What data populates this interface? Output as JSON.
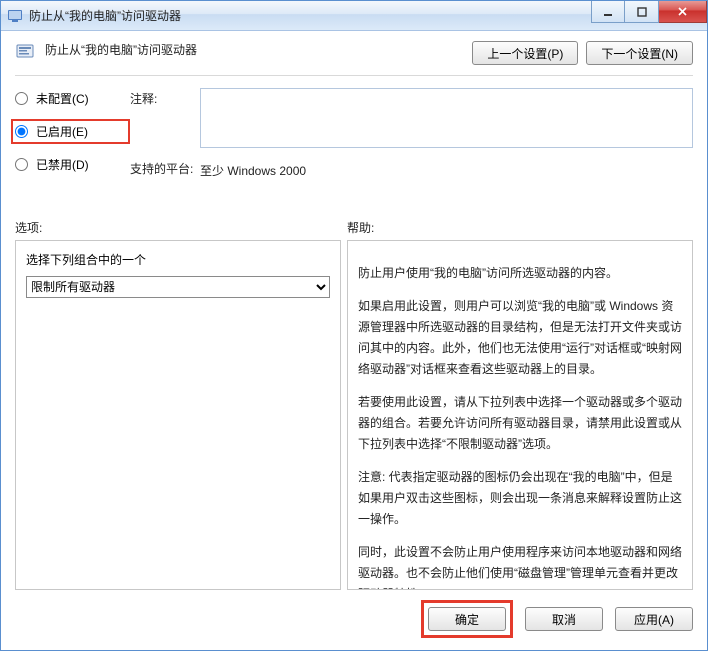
{
  "window": {
    "title": "防止从“我的电脑”访问驱动器"
  },
  "header": {
    "title": "防止从“我的电脑”访问驱动器",
    "prev_button": "上一个设置(P)",
    "next_button": "下一个设置(N)"
  },
  "state": {
    "not_configured": "未配置(C)",
    "enabled": "已启用(E)",
    "disabled": "已禁用(D)",
    "selected": "enabled"
  },
  "meta": {
    "comment_label": "注释:",
    "comment_value": "",
    "platform_label": "支持的平台:",
    "platform_value": "至少 Windows 2000"
  },
  "sections": {
    "options_label": "选项:",
    "help_label": "帮助:"
  },
  "options": {
    "caption": "选择下列组合中的一个",
    "selected": "限制所有驱动器",
    "choices": [
      "限制所有驱动器"
    ]
  },
  "help": {
    "p1": "防止用户使用“我的电脑”访问所选驱动器的内容。",
    "p2": "如果启用此设置，则用户可以浏览“我的电脑”或 Windows 资源管理器中所选驱动器的目录结构，但是无法打开文件夹或访问其中的内容。此外，他们也无法使用“运行”对话框或“映射网络驱动器”对话框来查看这些驱动器上的目录。",
    "p3": "若要使用此设置，请从下拉列表中选择一个驱动器或多个驱动器的组合。若要允许访问所有驱动器目录，请禁用此设置或从下拉列表中选择“不限制驱动器”选项。",
    "p4": "注意: 代表指定驱动器的图标仍会出现在“我的电脑”中，但是如果用户双击这些图标，则会出现一条消息来解释设置防止这一操作。",
    "p5": "同时，此设置不会防止用户使用程序来访问本地驱动器和网络驱动器。也不会防止他们使用“磁盘管理”管理单元查看并更改驱动器特性。"
  },
  "footer": {
    "ok": "确定",
    "cancel": "取消",
    "apply": "应用(A)"
  }
}
